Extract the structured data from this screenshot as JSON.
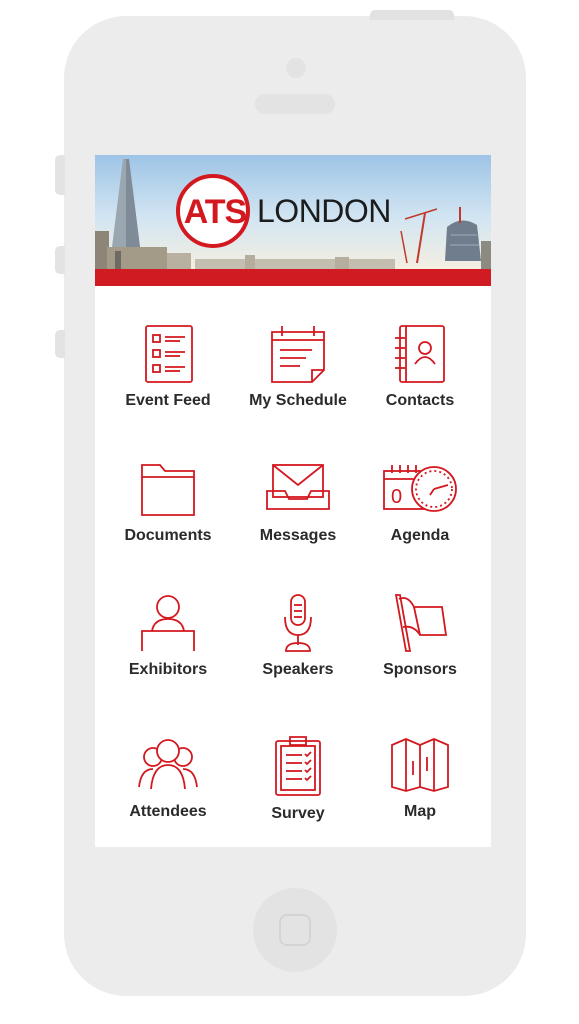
{
  "header": {
    "logo_mark": "ATS",
    "logo_city": "LONDON"
  },
  "colors": {
    "accent": "#d3181f",
    "device_frame": "#ececec",
    "label_text": "#2b2b2b"
  },
  "menu": [
    {
      "label": "Event Feed",
      "icon": "checklist-icon"
    },
    {
      "label": "My Schedule",
      "icon": "calendar-note-icon"
    },
    {
      "label": "Contacts",
      "icon": "address-book-icon"
    },
    {
      "label": "Documents",
      "icon": "folder-icon"
    },
    {
      "label": "Messages",
      "icon": "inbox-envelope-icon"
    },
    {
      "label": "Agenda",
      "icon": "calendar-clock-icon"
    },
    {
      "label": "Exhibitors",
      "icon": "booth-person-icon"
    },
    {
      "label": "Speakers",
      "icon": "microphone-icon"
    },
    {
      "label": "Sponsors",
      "icon": "flag-icon"
    },
    {
      "label": "Attendees",
      "icon": "people-group-icon"
    },
    {
      "label": "Survey",
      "icon": "clipboard-checklist-icon"
    },
    {
      "label": "Map",
      "icon": "folded-map-icon"
    }
  ]
}
